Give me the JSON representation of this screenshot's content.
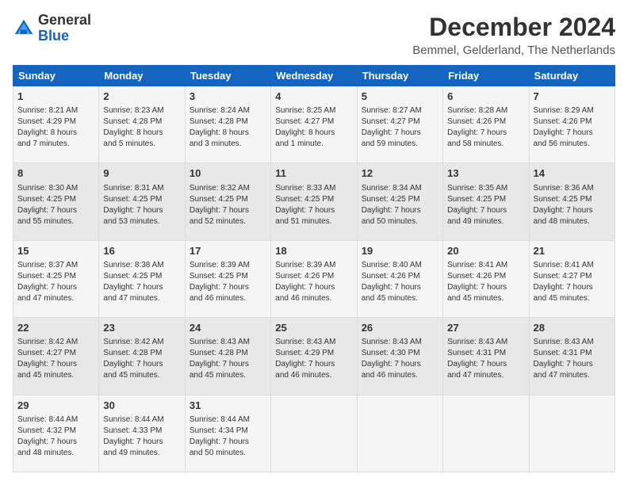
{
  "header": {
    "logo_line1": "General",
    "logo_line2": "Blue",
    "title": "December 2024",
    "subtitle": "Bemmel, Gelderland, The Netherlands"
  },
  "days_of_week": [
    "Sunday",
    "Monday",
    "Tuesday",
    "Wednesday",
    "Thursday",
    "Friday",
    "Saturday"
  ],
  "weeks": [
    [
      {
        "day": 1,
        "lines": [
          "Sunrise: 8:21 AM",
          "Sunset: 4:29 PM",
          "Daylight: 8 hours",
          "and 7 minutes."
        ]
      },
      {
        "day": 2,
        "lines": [
          "Sunrise: 8:23 AM",
          "Sunset: 4:28 PM",
          "Daylight: 8 hours",
          "and 5 minutes."
        ]
      },
      {
        "day": 3,
        "lines": [
          "Sunrise: 8:24 AM",
          "Sunset: 4:28 PM",
          "Daylight: 8 hours",
          "and 3 minutes."
        ]
      },
      {
        "day": 4,
        "lines": [
          "Sunrise: 8:25 AM",
          "Sunset: 4:27 PM",
          "Daylight: 8 hours",
          "and 1 minute."
        ]
      },
      {
        "day": 5,
        "lines": [
          "Sunrise: 8:27 AM",
          "Sunset: 4:27 PM",
          "Daylight: 7 hours",
          "and 59 minutes."
        ]
      },
      {
        "day": 6,
        "lines": [
          "Sunrise: 8:28 AM",
          "Sunset: 4:26 PM",
          "Daylight: 7 hours",
          "and 58 minutes."
        ]
      },
      {
        "day": 7,
        "lines": [
          "Sunrise: 8:29 AM",
          "Sunset: 4:26 PM",
          "Daylight: 7 hours",
          "and 56 minutes."
        ]
      }
    ],
    [
      {
        "day": 8,
        "lines": [
          "Sunrise: 8:30 AM",
          "Sunset: 4:25 PM",
          "Daylight: 7 hours",
          "and 55 minutes."
        ]
      },
      {
        "day": 9,
        "lines": [
          "Sunrise: 8:31 AM",
          "Sunset: 4:25 PM",
          "Daylight: 7 hours",
          "and 53 minutes."
        ]
      },
      {
        "day": 10,
        "lines": [
          "Sunrise: 8:32 AM",
          "Sunset: 4:25 PM",
          "Daylight: 7 hours",
          "and 52 minutes."
        ]
      },
      {
        "day": 11,
        "lines": [
          "Sunrise: 8:33 AM",
          "Sunset: 4:25 PM",
          "Daylight: 7 hours",
          "and 51 minutes."
        ]
      },
      {
        "day": 12,
        "lines": [
          "Sunrise: 8:34 AM",
          "Sunset: 4:25 PM",
          "Daylight: 7 hours",
          "and 50 minutes."
        ]
      },
      {
        "day": 13,
        "lines": [
          "Sunrise: 8:35 AM",
          "Sunset: 4:25 PM",
          "Daylight: 7 hours",
          "and 49 minutes."
        ]
      },
      {
        "day": 14,
        "lines": [
          "Sunrise: 8:36 AM",
          "Sunset: 4:25 PM",
          "Daylight: 7 hours",
          "and 48 minutes."
        ]
      }
    ],
    [
      {
        "day": 15,
        "lines": [
          "Sunrise: 8:37 AM",
          "Sunset: 4:25 PM",
          "Daylight: 7 hours",
          "and 47 minutes."
        ]
      },
      {
        "day": 16,
        "lines": [
          "Sunrise: 8:38 AM",
          "Sunset: 4:25 PM",
          "Daylight: 7 hours",
          "and 47 minutes."
        ]
      },
      {
        "day": 17,
        "lines": [
          "Sunrise: 8:39 AM",
          "Sunset: 4:25 PM",
          "Daylight: 7 hours",
          "and 46 minutes."
        ]
      },
      {
        "day": 18,
        "lines": [
          "Sunrise: 8:39 AM",
          "Sunset: 4:26 PM",
          "Daylight: 7 hours",
          "and 46 minutes."
        ]
      },
      {
        "day": 19,
        "lines": [
          "Sunrise: 8:40 AM",
          "Sunset: 4:26 PM",
          "Daylight: 7 hours",
          "and 45 minutes."
        ]
      },
      {
        "day": 20,
        "lines": [
          "Sunrise: 8:41 AM",
          "Sunset: 4:26 PM",
          "Daylight: 7 hours",
          "and 45 minutes."
        ]
      },
      {
        "day": 21,
        "lines": [
          "Sunrise: 8:41 AM",
          "Sunset: 4:27 PM",
          "Daylight: 7 hours",
          "and 45 minutes."
        ]
      }
    ],
    [
      {
        "day": 22,
        "lines": [
          "Sunrise: 8:42 AM",
          "Sunset: 4:27 PM",
          "Daylight: 7 hours",
          "and 45 minutes."
        ]
      },
      {
        "day": 23,
        "lines": [
          "Sunrise: 8:42 AM",
          "Sunset: 4:28 PM",
          "Daylight: 7 hours",
          "and 45 minutes."
        ]
      },
      {
        "day": 24,
        "lines": [
          "Sunrise: 8:43 AM",
          "Sunset: 4:28 PM",
          "Daylight: 7 hours",
          "and 45 minutes."
        ]
      },
      {
        "day": 25,
        "lines": [
          "Sunrise: 8:43 AM",
          "Sunset: 4:29 PM",
          "Daylight: 7 hours",
          "and 46 minutes."
        ]
      },
      {
        "day": 26,
        "lines": [
          "Sunrise: 8:43 AM",
          "Sunset: 4:30 PM",
          "Daylight: 7 hours",
          "and 46 minutes."
        ]
      },
      {
        "day": 27,
        "lines": [
          "Sunrise: 8:43 AM",
          "Sunset: 4:31 PM",
          "Daylight: 7 hours",
          "and 47 minutes."
        ]
      },
      {
        "day": 28,
        "lines": [
          "Sunrise: 8:43 AM",
          "Sunset: 4:31 PM",
          "Daylight: 7 hours",
          "and 47 minutes."
        ]
      }
    ],
    [
      {
        "day": 29,
        "lines": [
          "Sunrise: 8:44 AM",
          "Sunset: 4:32 PM",
          "Daylight: 7 hours",
          "and 48 minutes."
        ]
      },
      {
        "day": 30,
        "lines": [
          "Sunrise: 8:44 AM",
          "Sunset: 4:33 PM",
          "Daylight: 7 hours",
          "and 49 minutes."
        ]
      },
      {
        "day": 31,
        "lines": [
          "Sunrise: 8:44 AM",
          "Sunset: 4:34 PM",
          "Daylight: 7 hours",
          "and 50 minutes."
        ]
      },
      null,
      null,
      null,
      null
    ]
  ]
}
